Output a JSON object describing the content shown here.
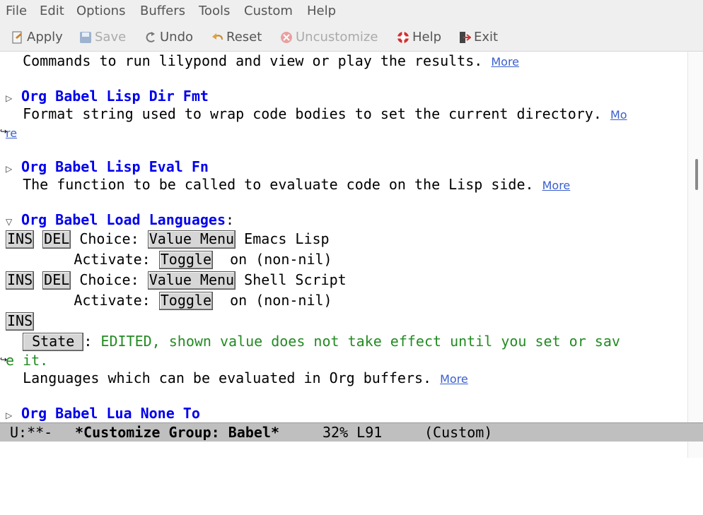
{
  "menubar": [
    "File",
    "Edit",
    "Options",
    "Buffers",
    "Tools",
    "Custom",
    "Help"
  ],
  "toolbar": {
    "apply": "Apply",
    "save": "Save",
    "undo": "Undo",
    "reset": "Reset",
    "uncustomize": "Uncustomize",
    "help": "Help",
    "exit": "Exit"
  },
  "buffer": {
    "lilypond_doc": "Commands to run lilypond and view or play the results.",
    "more": "More",
    "dirfmt_title": "Org Babel Lisp Dir Fmt",
    "dirfmt_doc": "Format string used to wrap code bodies to set the current directory.",
    "dirfmt_more_a": "Mo",
    "dirfmt_more_b": "re",
    "evalfn_title": "Org Babel Lisp Eval Fn",
    "evalfn_doc": "The function to be called to evaluate code on the Lisp side.",
    "load_title": "Org Babel Load Languages",
    "load_colon": ":",
    "ins": "INS",
    "del": "DEL",
    "choice": "Choice:",
    "value_menu": "Value Menu",
    "lang1": "Emacs Lisp",
    "activate": "Activate:",
    "toggle": "Toggle",
    "on_state": "on (non-nil)",
    "lang2": "Shell Script",
    "state_btn": "State",
    "state_colon": ":",
    "state_msg_a": "EDITED, shown value does not take effect until you set or sav",
    "state_msg_b": "e it.",
    "load_doc": "Languages which can be evaluated in Org buffers.",
    "lua_title": "Org Babel Lua None To"
  },
  "modeline": {
    "status": "U:**-",
    "buffer_name": "*Customize Group: Babel*",
    "position": "32% L91",
    "mode": "(Custom)"
  }
}
